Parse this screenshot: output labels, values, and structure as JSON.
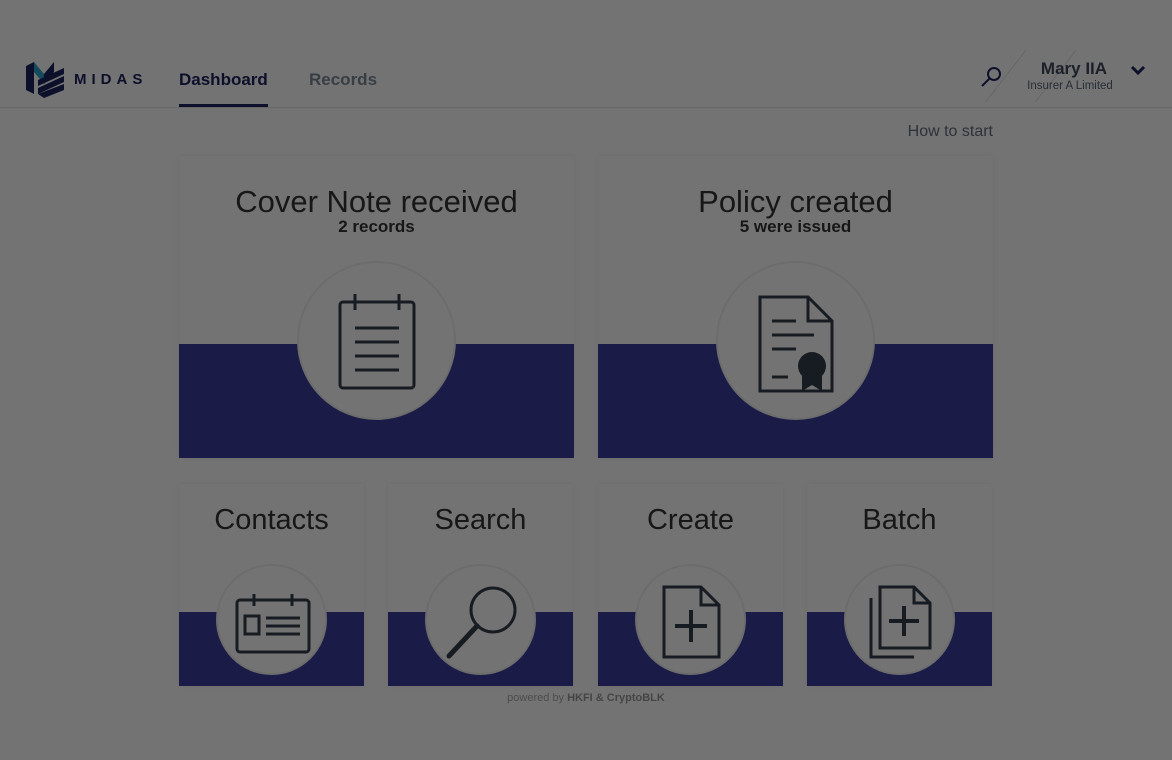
{
  "colors": {
    "navy": "#1e2460",
    "band": "#3a3f9e",
    "muted": "#7d8a96",
    "overlay": "rgba(0,0,0,0.55)"
  },
  "header": {
    "logo_text": "MIDAS",
    "tabs": [
      {
        "label": "Dashboard",
        "active": true
      },
      {
        "label": "Records",
        "active": false
      }
    ],
    "search_icon": "search-icon",
    "user": {
      "name": "Mary IIA",
      "org": "Insurer A Limited",
      "menu_icon": "chevron-down-icon"
    }
  },
  "how_to_start": "How to start",
  "cards": {
    "cover_note": {
      "title": "Cover Note received",
      "subtitle": "2 records",
      "icon": "clipboard-icon"
    },
    "policy": {
      "title": "Policy created",
      "subtitle": "5 were issued",
      "icon": "certificate-document-icon"
    },
    "contacts": {
      "title": "Contacts",
      "icon": "contact-card-icon"
    },
    "search": {
      "title": "Search",
      "icon": "magnifier-icon"
    },
    "create": {
      "title": "Create",
      "icon": "new-document-icon"
    },
    "batch": {
      "title": "Batch",
      "icon": "batch-documents-icon"
    }
  },
  "footer": {
    "prefix": "powered by",
    "brand": "HKFI & CryptoBLK"
  }
}
